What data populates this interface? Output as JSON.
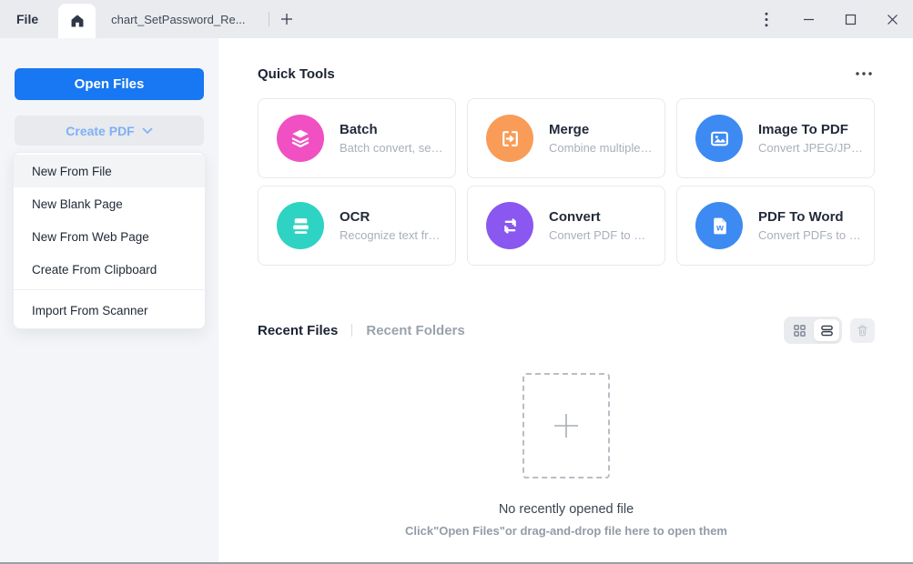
{
  "titlebar": {
    "file_menu_label": "File",
    "document_tab_title": "chart_SetPassword_Re...",
    "home_tab_icon": "home-icon",
    "controls": [
      "more-options",
      "minimize",
      "maximize",
      "close"
    ]
  },
  "sidebar": {
    "open_files_label": "Open Files",
    "create_pdf_label": "Create PDF",
    "create_pdf_menu": {
      "items": [
        "New From File",
        "New Blank Page",
        "New From Web Page",
        "Create From Clipboard",
        "Import From Scanner"
      ],
      "highlighted_item": "New From File"
    }
  },
  "main": {
    "quick_tools": {
      "title": "Quick Tools",
      "cards": [
        {
          "title": "Batch",
          "subtitle": "Batch convert, secur...",
          "icon": "layers-icon",
          "color": "#F050C2"
        },
        {
          "title": "Merge",
          "subtitle": "Combine multiple d...",
          "icon": "merge-icon",
          "color": "#F89C58"
        },
        {
          "title": "Image To PDF",
          "subtitle": "Convert JPEG/JPG/PN...",
          "icon": "image-icon",
          "color": "#3D8AF2"
        },
        {
          "title": "OCR",
          "subtitle": "Recognize text from i...",
          "icon": "ocr-scan-icon",
          "color": "#2ED3C3"
        },
        {
          "title": "Convert",
          "subtitle": "Convert PDF to Wor...",
          "icon": "sync-arrows-icon",
          "color": "#8A57F0"
        },
        {
          "title": "PDF To Word",
          "subtitle": "Convert PDFs to Wo...",
          "icon": "word-document-icon",
          "color": "#3D8AF2"
        }
      ]
    },
    "recent": {
      "tabs": [
        {
          "label": "Recent Files",
          "active": true
        },
        {
          "label": "Recent Folders",
          "active": false
        }
      ],
      "view_toggle": {
        "options": [
          "grid-view",
          "list-view"
        ],
        "selected": "list-view"
      },
      "trash_icon": "trash-icon",
      "empty_state": {
        "title": "No recently opened file",
        "subtitle": "Click\"Open Files\"or drag-and-drop file here to open them"
      }
    }
  },
  "colors": {
    "accent_blue": "#1877F2",
    "create_pdf_text": "#7FB0F5",
    "titlebar_bg": "#E9EBEE",
    "sidebar_bg": "#F4F5F8"
  }
}
